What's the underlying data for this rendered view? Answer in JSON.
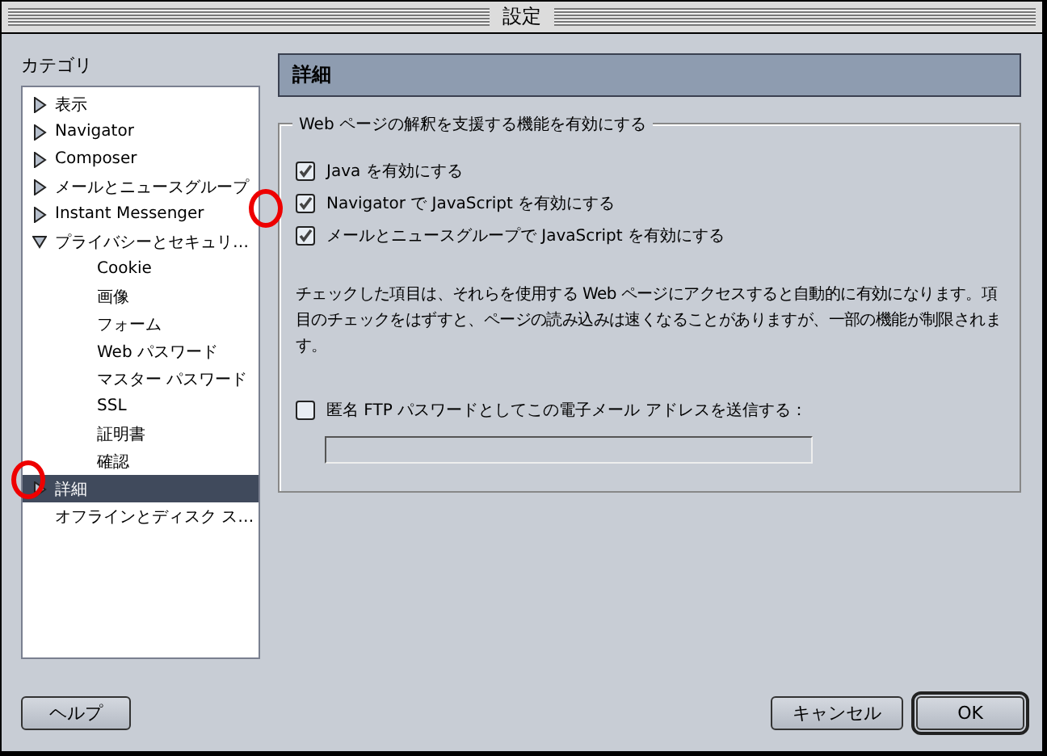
{
  "window": {
    "title": "設定"
  },
  "sidebar": {
    "label": "カテゴリ",
    "items": [
      {
        "label": "表示",
        "expanded": false,
        "selected": false
      },
      {
        "label": "Navigator",
        "expanded": false,
        "selected": false
      },
      {
        "label": "Composer",
        "expanded": false,
        "selected": false
      },
      {
        "label": "メールとニュースグループ",
        "expanded": false,
        "selected": false
      },
      {
        "label": "Instant Messenger",
        "expanded": false,
        "selected": false
      },
      {
        "label": "プライバシーとセキュリ…",
        "expanded": true,
        "selected": false,
        "children": [
          {
            "label": "Cookie",
            "selected": false
          },
          {
            "label": "画像",
            "selected": false
          },
          {
            "label": "フォーム",
            "selected": false
          },
          {
            "label": "Web パスワード",
            "selected": false
          },
          {
            "label": "マスター パスワード",
            "selected": false
          },
          {
            "label": "SSL",
            "selected": false
          },
          {
            "label": "証明書",
            "selected": false
          },
          {
            "label": "確認",
            "selected": false
          }
        ]
      },
      {
        "label": "詳細",
        "expanded": false,
        "selected": true
      },
      {
        "label": "オフラインとディスク ス…",
        "selected": false
      }
    ]
  },
  "panel": {
    "title": "詳細",
    "group": {
      "legend": "Web ページの解釈を支援する機能を有効にする",
      "options": [
        {
          "label": "Java を有効にする",
          "checked": true
        },
        {
          "label": "Navigator で JavaScript を有効にする",
          "checked": true
        },
        {
          "label": "メールとニュースグループで JavaScript を有効にする",
          "checked": true
        }
      ],
      "note": "チェックした項目は、それらを使用する Web ページにアクセスすると自動的に有効になります。項目のチェックをはずすと、ページの読み込みは速くなることがありますが、一部の機能が制限されます。",
      "ftp_option": {
        "label": "匿名 FTP パスワードとしてこの電子メール アドレスを送信する：",
        "checked": false
      }
    }
  },
  "buttons": [
    {
      "label": "ヘルプ",
      "kind": "help"
    },
    {
      "label": "キャンセル",
      "kind": "cancel"
    },
    {
      "label": "OK",
      "kind": "default"
    }
  ]
}
